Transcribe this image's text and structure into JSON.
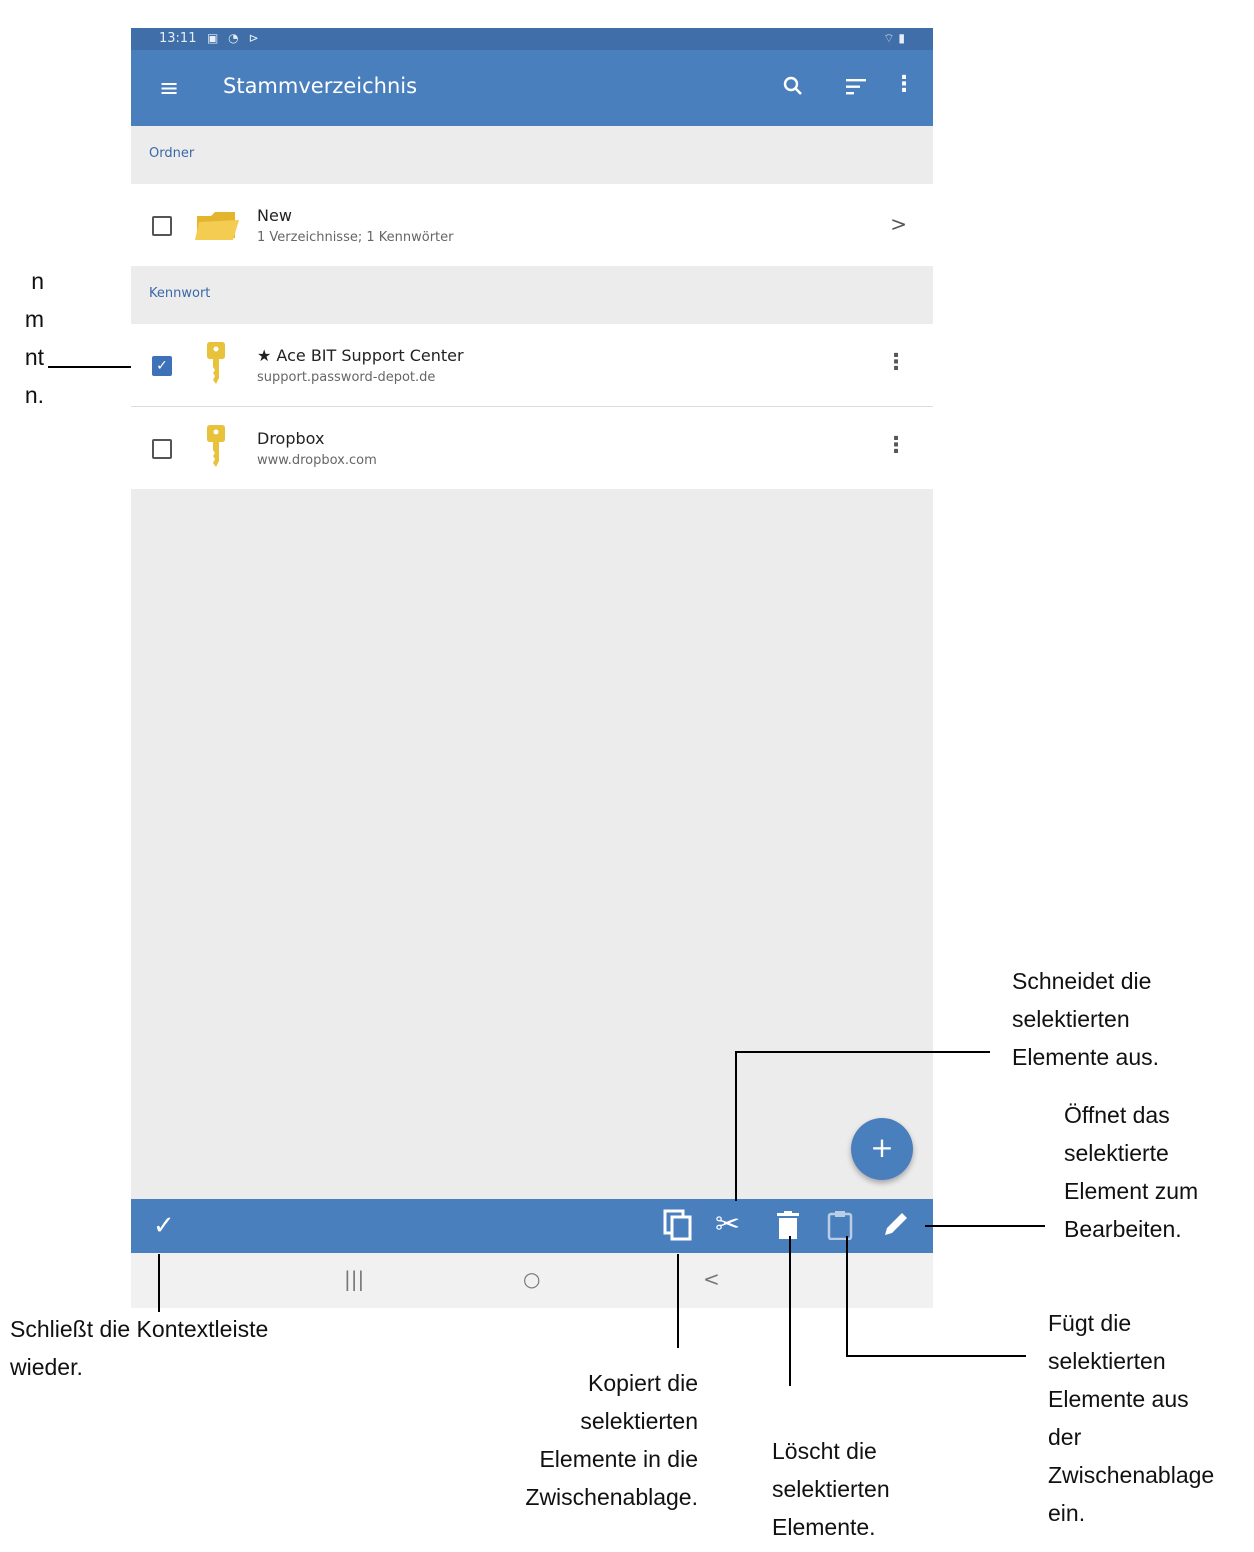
{
  "status": {
    "time": "13:11",
    "icons": "▣ ◔ ⊳",
    "battery": "⌔ ▮"
  },
  "appbar": {
    "title": "Stammverzeichnis"
  },
  "sections": {
    "folders": "Ordner",
    "passwords": "Kennwort"
  },
  "folders": [
    {
      "name": "New",
      "detail": "1 Verzeichnisse; 1 Kennwörter",
      "checked": false
    }
  ],
  "entries": [
    {
      "name": "★ Ace BIT Support Center",
      "detail": "support.password-depot.de",
      "checked": true
    },
    {
      "name": "Dropbox",
      "detail": "www.dropbox.com",
      "checked": false
    }
  ],
  "glyphs": {
    "menu": "≡",
    "search": "⚲",
    "sort": "≡",
    "more": "⋮",
    "chevron": ">",
    "fab": "+",
    "check": "✓",
    "checkbox_check": "✓",
    "copy": "⧉",
    "cut": "✂",
    "delete": "▮",
    "paste": "▭",
    "edit": "✎",
    "nav_recent": "|||",
    "nav_home": "○",
    "nav_back": "<"
  },
  "annotations": {
    "left_partial": [
      "n",
      "m",
      "nt",
      "n."
    ],
    "close": [
      "Schließt die Kontextleiste",
      "wieder."
    ],
    "copy": [
      "Kopiert die",
      "selektierten",
      "Elemente in die",
      "Zwischenablage."
    ],
    "delete": [
      "Löscht die",
      "selektierten",
      "Elemente."
    ],
    "paste": [
      "Fügt die",
      "selektierten",
      "Elemente aus",
      "der",
      "Zwischenablage",
      "ein."
    ],
    "cut": [
      "Schneidet die",
      "selektierten",
      "Elemente aus."
    ],
    "edit": [
      "Öffnet das",
      "selektierte",
      "Element zum",
      "Bearbeiten."
    ]
  },
  "colors": {
    "accent": "#4a7fbe",
    "statusbar": "#3f6ea8",
    "key": "#e8c23a",
    "folder": "#f0c040",
    "section_label": "#3a68a8"
  }
}
